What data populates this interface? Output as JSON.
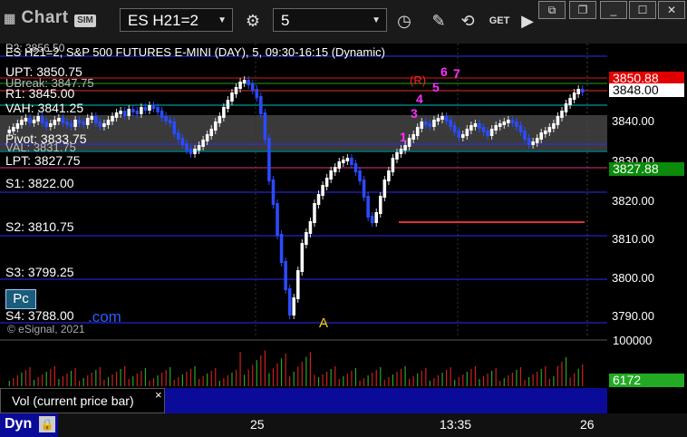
{
  "toolbar": {
    "logo": "Chart",
    "sim": "SIM",
    "symbol": "ES H21=2",
    "interval": "5",
    "get_label": "GET"
  },
  "chart": {
    "title": "ES H21=2, S&P 500 FUTURES E-MINI (DAY), 5, 09:30-16:15 (Dynamic)",
    "levels": [
      {
        "label": "R2: 3856.50"
      },
      {
        "label": "UPT: 3850.75"
      },
      {
        "label": "UBreak: 3847.75"
      },
      {
        "label": "R1: 3845.00"
      },
      {
        "label": "VAH: 3841.25"
      },
      {
        "label": "Pivot: 3833.75"
      },
      {
        "label": "VAL: 3831.75"
      },
      {
        "label": "LPT: 3827.75"
      },
      {
        "label": "S1: 3822.00"
      },
      {
        "label": "S2: 3810.75"
      },
      {
        "label": "S3: 3799.25"
      },
      {
        "label": "S4: 3788.00"
      }
    ],
    "lpt_suffix": "00",
    "pc_badge": "Pc",
    "com_text": ".com",
    "copyright": "© eSignal, 2021",
    "marker_a": "A",
    "price_ticks": [
      "3840.00",
      "3830.00",
      "3820.00",
      "3810.00",
      "3800.00",
      "3790.00"
    ],
    "price_boxes": {
      "red": "3850.88",
      "white": "3848.00",
      "green": "3827.88"
    },
    "seq_labels": {
      "r": "(R)",
      "five": "5",
      "six": "6",
      "seven": "7",
      "four": "4",
      "three": "3",
      "one": "1"
    },
    "time_ticks": [
      "25",
      "13:35",
      "26"
    ]
  },
  "volume": {
    "axis_top": "100000",
    "last": "6172",
    "label": "Vol (current price bar)",
    "close": "×"
  },
  "bottom": {
    "dyn": "Dyn"
  },
  "chart_data": {
    "type": "candlestick",
    "title": "ES H21=2, S&P 500 FUTURES E-MINI (DAY), 5, 09:30-16:15 (Dynamic)",
    "y_range": [
      3786,
      3860
    ],
    "levels": {
      "R2": 3856.5,
      "UPT": 3850.75,
      "UBreak": 3847.75,
      "R1": 3845.0,
      "VAH": 3841.25,
      "Pivot": 3833.75,
      "VAL": 3831.75,
      "LPT": 3827.75,
      "S1": 3822.0,
      "S2": 3810.75,
      "S3": 3799.25,
      "S4": 3788.0
    },
    "last_price": 3848.0,
    "last_volume": 6172
  }
}
